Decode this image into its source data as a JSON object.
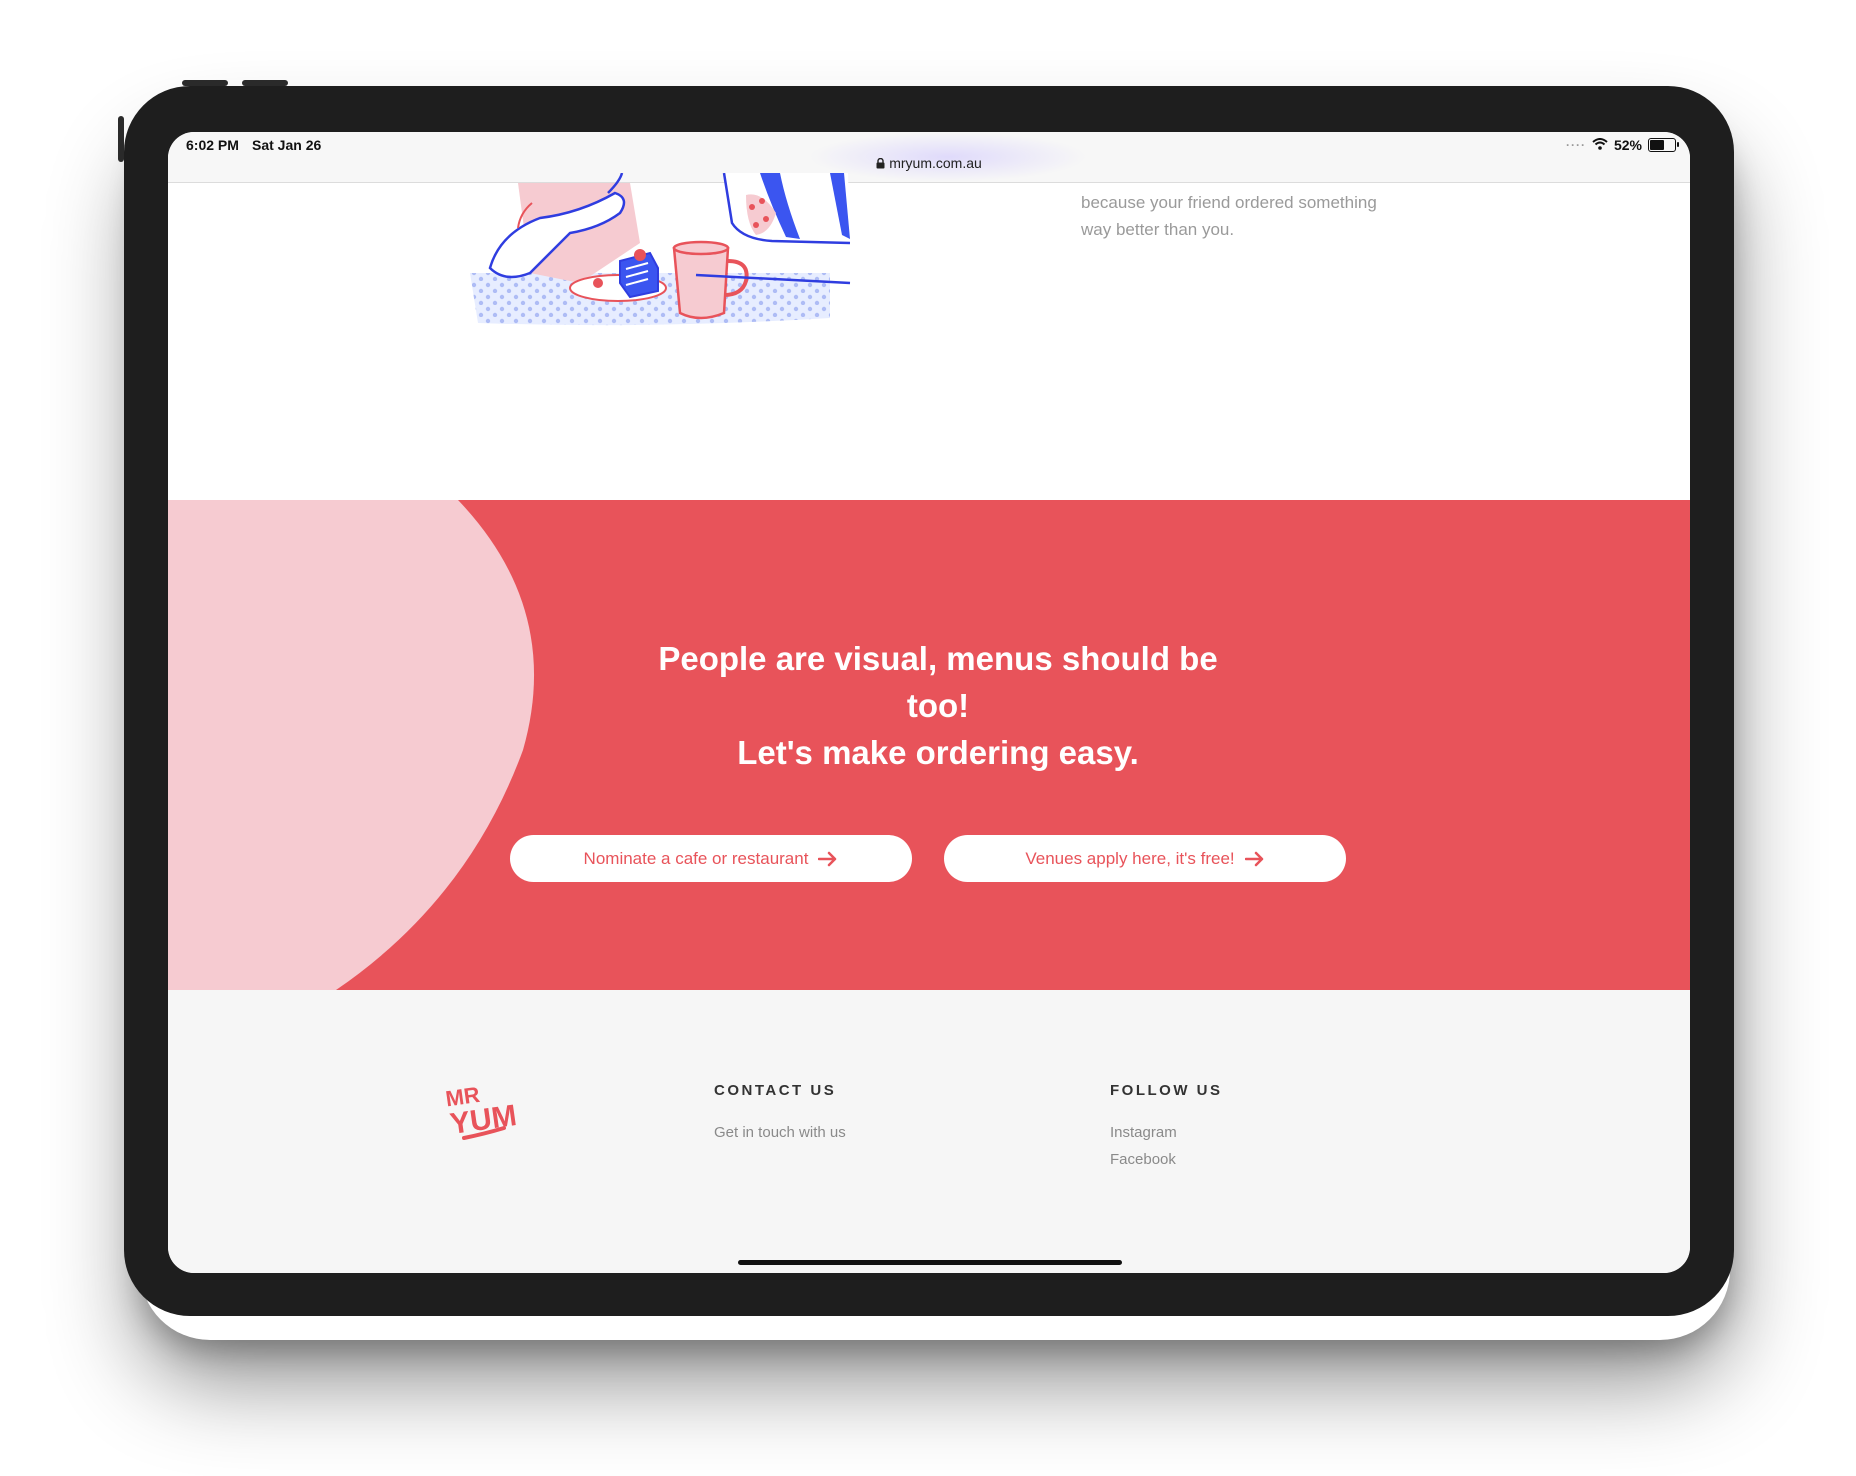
{
  "status_bar": {
    "time": "6:02 PM",
    "date": "Sat Jan 26",
    "url": "mryum.com.au",
    "battery": "52%"
  },
  "hero": {
    "side_text": "because your friend ordered something way better than you."
  },
  "cta": {
    "heading_line1": "People are visual, menus should be",
    "heading_line2": "too!",
    "heading_line3": "Let's make ordering easy.",
    "nominate_label": "Nominate a cafe or restaurant",
    "venues_label": "Venues apply here, it's free!"
  },
  "footer": {
    "logo_line1": "MR",
    "logo_line2": "YUM",
    "contact_title": "CONTACT US",
    "contact_link": "Get in touch with us",
    "follow_title": "FOLLOW US",
    "instagram": "Instagram",
    "facebook": "Facebook"
  },
  "colors": {
    "brand_red": "#e8535a",
    "blob_pink": "#f6cbd1",
    "footer_bg": "#f6f6f6"
  },
  "icons": [
    "lock-icon",
    "wifi-icon",
    "battery-icon",
    "arrow-right-icon"
  ]
}
